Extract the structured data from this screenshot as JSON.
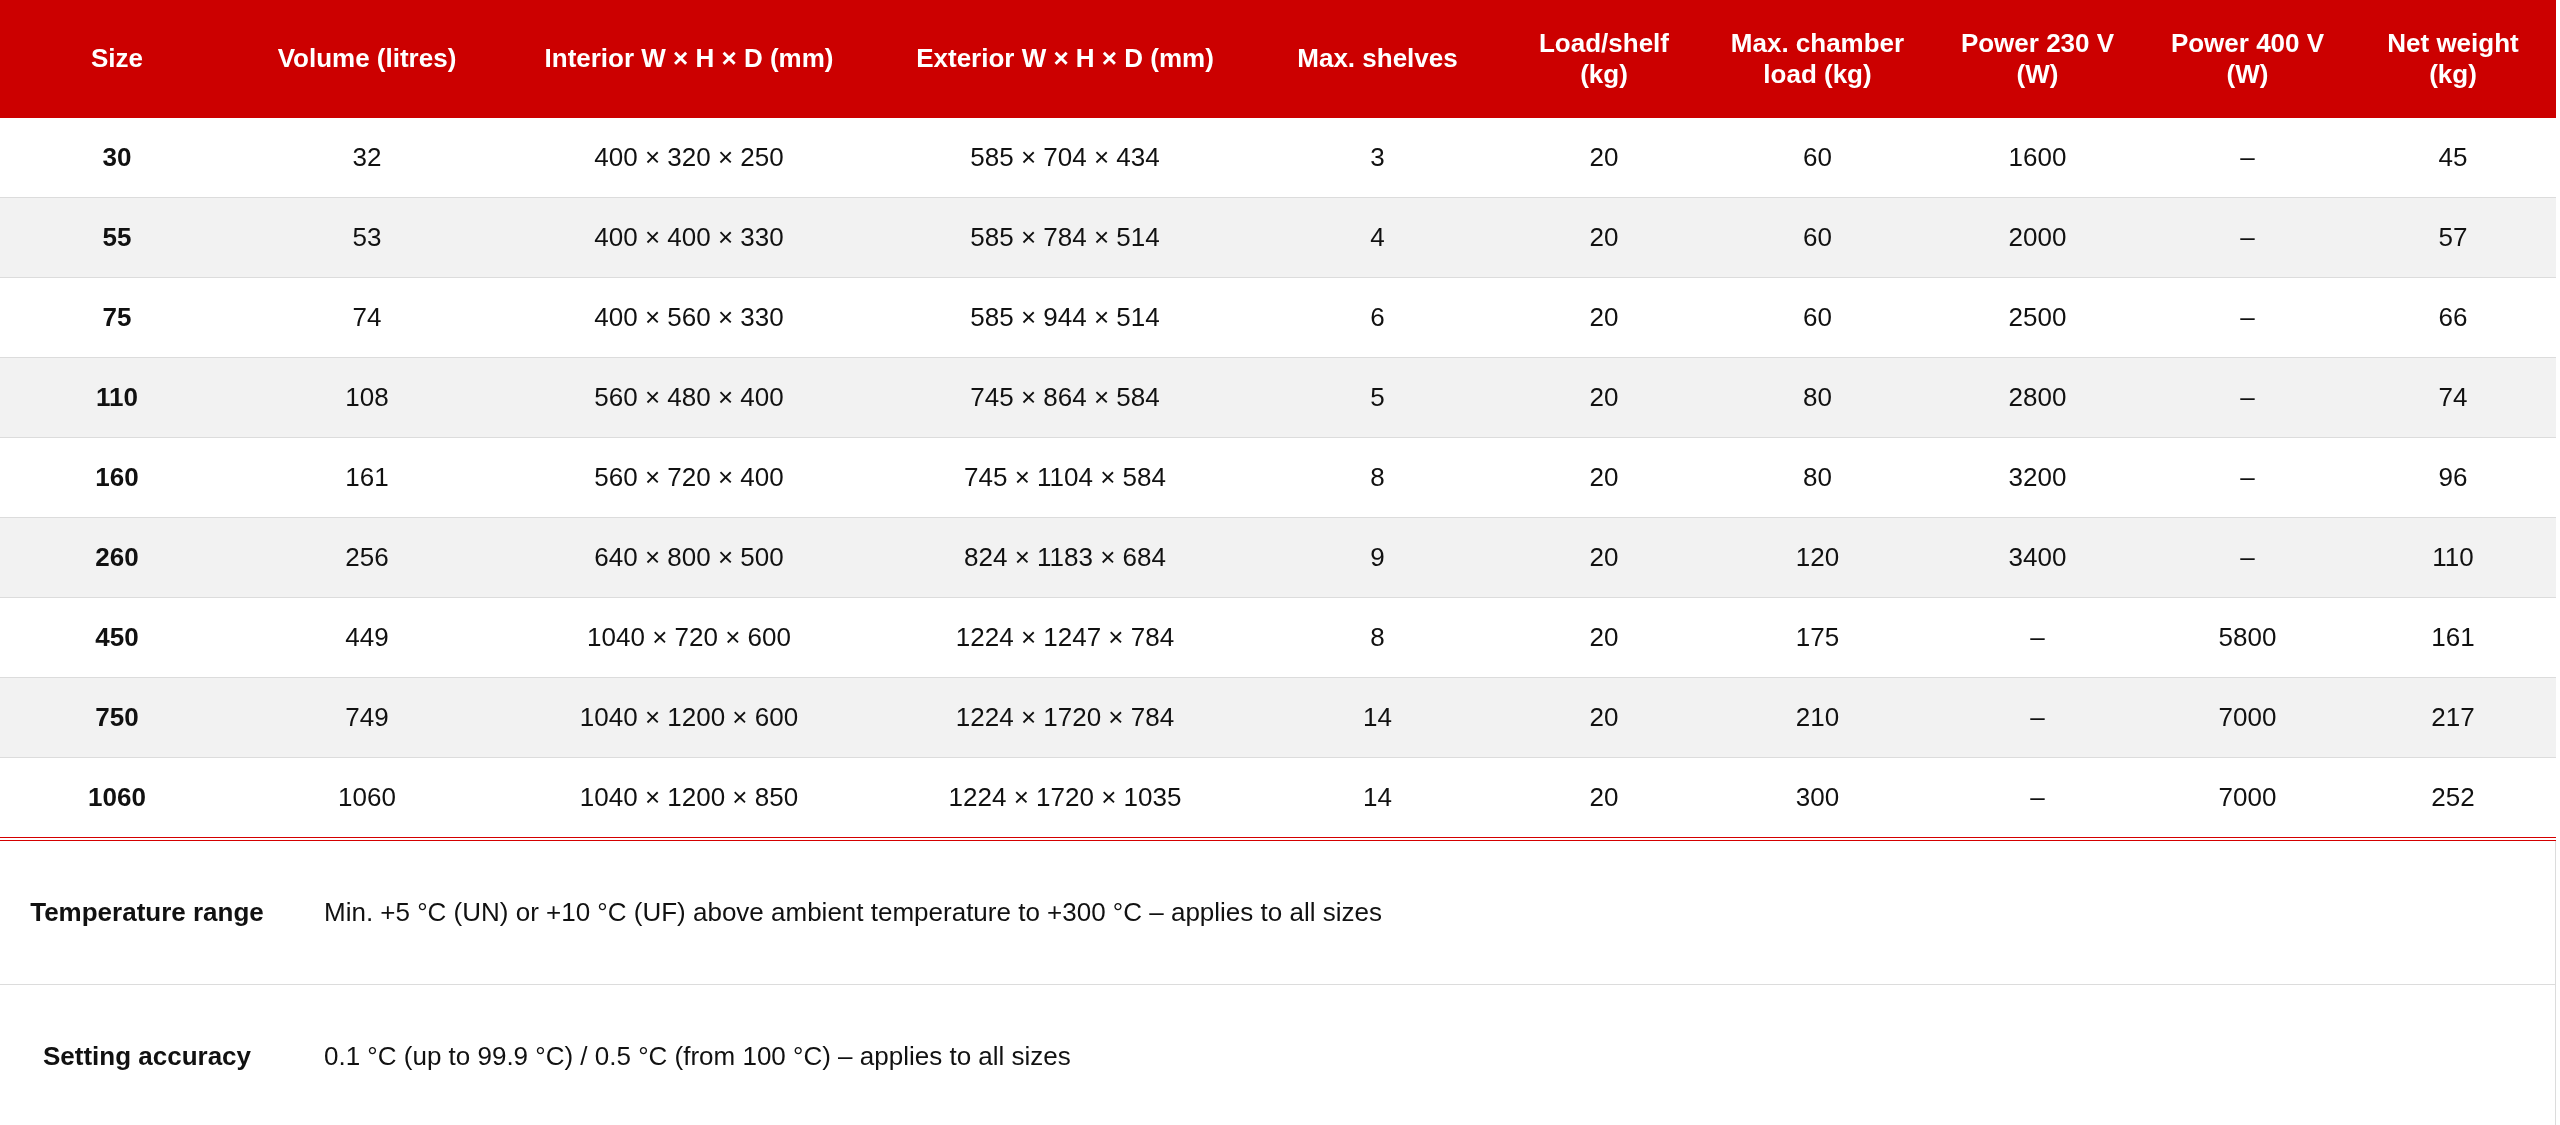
{
  "table": {
    "columns": [
      "Size",
      "Volume (litres)",
      "Interior W × H × D (mm)",
      "Exterior W × H × D (mm)",
      "Max. shelves",
      "Load/shelf (kg)",
      "Max. chamber load (kg)",
      "Power 230 V (W)",
      "Power 400 V (W)",
      "Net weight (kg)"
    ],
    "rows": [
      [
        "30",
        "32",
        "400 × 320 × 250",
        "585 × 704 × 434",
        "3",
        "20",
        "60",
        "1600",
        "–",
        "45"
      ],
      [
        "55",
        "53",
        "400 × 400 × 330",
        "585 × 784 × 514",
        "4",
        "20",
        "60",
        "2000",
        "–",
        "57"
      ],
      [
        "75",
        "74",
        "400 × 560 × 330",
        "585 × 944 × 514",
        "6",
        "20",
        "60",
        "2500",
        "–",
        "66"
      ],
      [
        "110",
        "108",
        "560 × 480 × 400",
        "745 × 864 × 584",
        "5",
        "20",
        "80",
        "2800",
        "–",
        "74"
      ],
      [
        "160",
        "161",
        "560 × 720 × 400",
        "745 × 1104 × 584",
        "8",
        "20",
        "80",
        "3200",
        "–",
        "96"
      ],
      [
        "260",
        "256",
        "640 × 800 × 500",
        "824 × 1183 × 684",
        "9",
        "20",
        "120",
        "3400",
        "–",
        "110"
      ],
      [
        "450",
        "449",
        "1040 × 720 × 600",
        "1224 × 1247 × 784",
        "8",
        "20",
        "175",
        "–",
        "5800",
        "161"
      ],
      [
        "750",
        "749",
        "1040 × 1200 × 600",
        "1224 × 1720 × 784",
        "14",
        "20",
        "210",
        "–",
        "7000",
        "217"
      ],
      [
        "1060",
        "1060",
        "1040 × 1200 × 850",
        "1224 × 1720 × 1035",
        "14",
        "20",
        "300",
        "–",
        "7000",
        "252"
      ]
    ]
  },
  "specs": [
    {
      "label": "Temperature range",
      "value": "Min. +5 °C (UN) or +10 °C (UF) above ambient temperature to +300 °C – applies to all sizes"
    },
    {
      "label": "Setting accuracy",
      "value": "0.1 °C (up to 99.9 °C) / 0.5 °C (from 100 °C) – applies to all sizes"
    }
  ]
}
